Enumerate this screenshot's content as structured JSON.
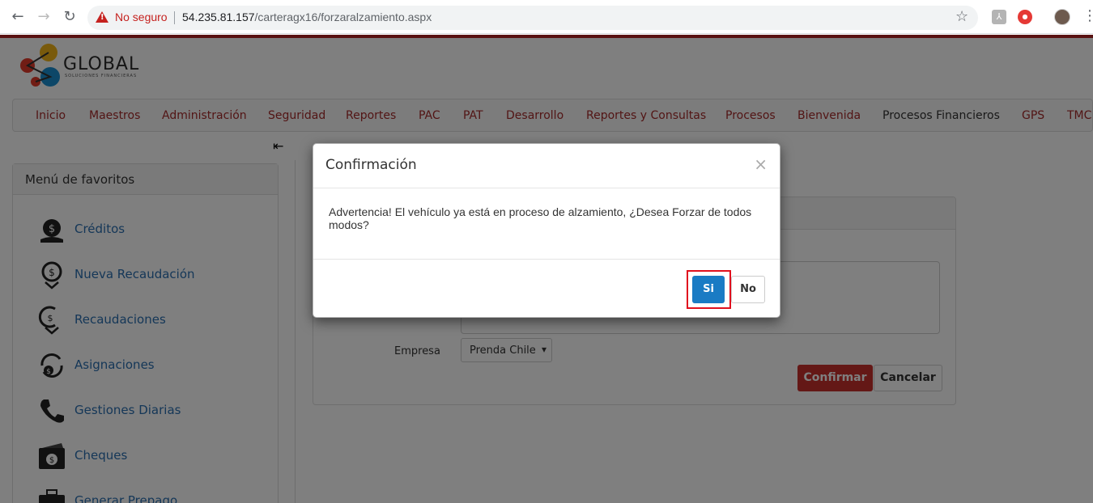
{
  "browser": {
    "security_label": "No seguro",
    "url_host": "54.235.81.157",
    "url_path": "/carteragx16/forzaralzamiento.aspx"
  },
  "logo": {
    "text": "GLOBAL",
    "subtext": "SOLUCIONES FINANCIERAS"
  },
  "menu": {
    "items": [
      {
        "label": "Inicio"
      },
      {
        "label": "Maestros"
      },
      {
        "label": "Administración"
      },
      {
        "label": "Seguridad"
      },
      {
        "label": "Reportes"
      },
      {
        "label": "PAC"
      },
      {
        "label": "PAT"
      },
      {
        "label": "Desarrollo"
      },
      {
        "label": "Reportes y Consultas"
      },
      {
        "label": "Procesos"
      },
      {
        "label": "Bienvenida"
      },
      {
        "label": "Procesos Financieros"
      },
      {
        "label": "GPS"
      },
      {
        "label": "TMC"
      }
    ]
  },
  "favorites": {
    "title": "Menú de favoritos",
    "items": [
      {
        "label": "Créditos",
        "icon": "credit-coin-icon"
      },
      {
        "label": "Nueva Recaudación",
        "icon": "new-collection-icon"
      },
      {
        "label": "Recaudaciones",
        "icon": "collections-icon"
      },
      {
        "label": "Asignaciones",
        "icon": "assignments-icon"
      },
      {
        "label": "Gestiones Diarias",
        "icon": "phone-icon"
      },
      {
        "label": "Cheques",
        "icon": "cheque-icon"
      },
      {
        "label": "Generar Prepago",
        "icon": "briefcase-icon"
      }
    ]
  },
  "form": {
    "empresa_label": "Empresa",
    "empresa_value": "Prenda Chile",
    "confirm_label": "Confirmar",
    "cancel_label": "Cancelar"
  },
  "modal": {
    "title": "Confirmación",
    "close": "×",
    "message": "Advertencia! El vehículo ya está en proceso de alzamiento, ¿Desea Forzar de todos modos?",
    "yes_label": "Si",
    "no_label": "No"
  },
  "colors": {
    "brand_red": "#b22222",
    "menu_link": "#a52a2a",
    "fav_link": "#2a6fb0",
    "primary_blue": "#1a7bc4",
    "danger": "#c9302c",
    "highlight": "#e0101e"
  }
}
